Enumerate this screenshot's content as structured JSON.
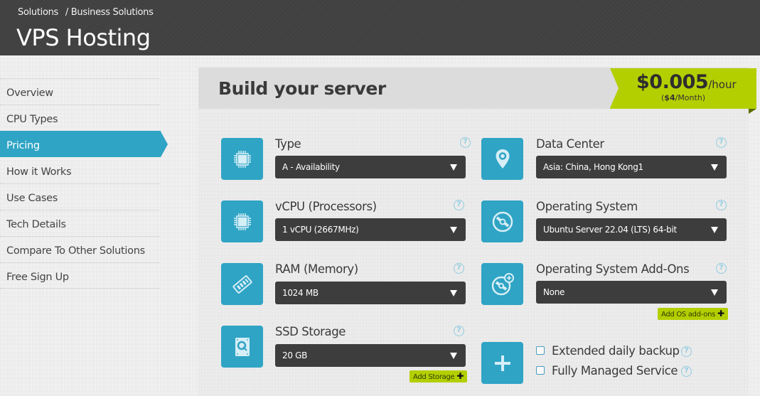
{
  "header": {
    "breadcrumb": [
      "Solutions",
      "/ Business Solutions"
    ],
    "title": "VPS Hosting"
  },
  "sidebar": {
    "items": [
      {
        "label": "Overview",
        "active": false
      },
      {
        "label": "CPU Types",
        "active": false
      },
      {
        "label": "Pricing",
        "active": true
      },
      {
        "label": "How it Works",
        "active": false
      },
      {
        "label": "Use Cases",
        "active": false
      },
      {
        "label": "Tech Details",
        "active": false
      },
      {
        "label": "Compare To Other Solutions",
        "active": false
      },
      {
        "label": "Free Sign Up",
        "active": false
      }
    ]
  },
  "builder": {
    "title": "Build your server",
    "price": {
      "amount": "$0.005",
      "unit": "/hour",
      "monthly_prefix": "(",
      "monthly_amount": "$4",
      "monthly_suffix": "/Month)"
    },
    "options": {
      "type": {
        "label": "Type",
        "value": "A - Availability",
        "icon": "cpu-chip-icon"
      },
      "vcpu": {
        "label": "vCPU (Processors)",
        "value": "1 vCPU (2667MHz)",
        "icon": "cpu-chip-icon"
      },
      "ram": {
        "label": "RAM (Memory)",
        "value": "1024 MB",
        "icon": "memory-stick-icon"
      },
      "ssd": {
        "label": "SSD Storage",
        "value": "20 GB",
        "icon": "hard-drive-icon",
        "add_label": "Add Storage"
      },
      "datacenter": {
        "label": "Data Center",
        "value": "Asia: China, Hong Kong1",
        "icon": "location-pin-icon"
      },
      "os": {
        "label": "Operating System",
        "value": "Ubuntu Server 22.04 (LTS) 64-bit",
        "icon": "disc-icon"
      },
      "os_addons": {
        "label": "Operating System Add-Ons",
        "value": "None",
        "icon": "disc-plus-icon",
        "add_label": "Add OS add-ons"
      }
    },
    "extras": {
      "icon": "plus-icon",
      "items": [
        {
          "label": "Extended daily backup",
          "checked": false
        },
        {
          "label": "Fully Managed Service",
          "checked": false
        }
      ]
    },
    "help_glyph": "?",
    "plus_glyph": "✚"
  }
}
